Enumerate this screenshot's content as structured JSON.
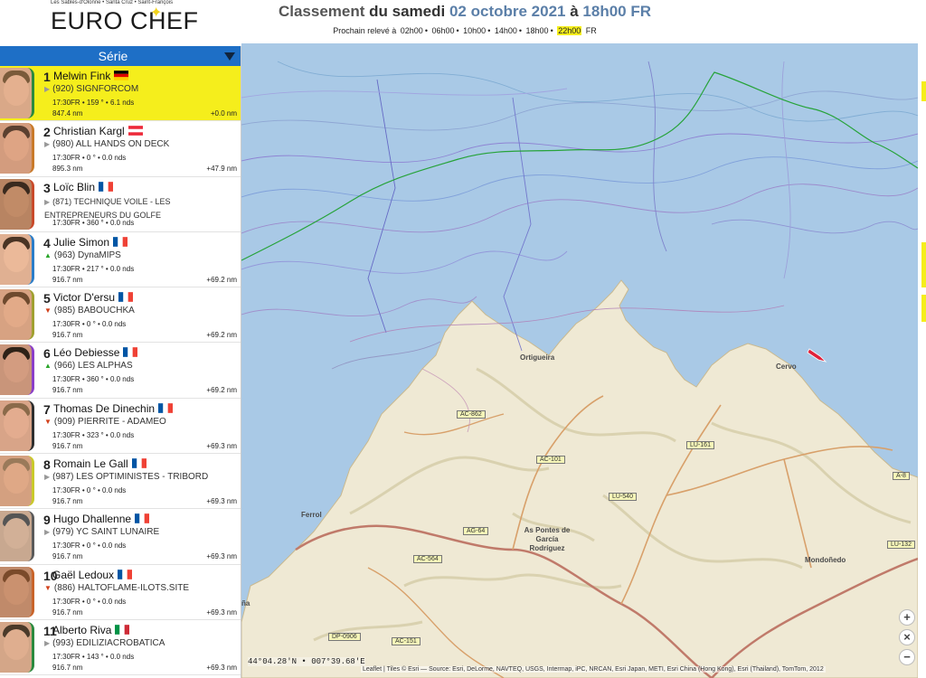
{
  "header": {
    "logo_tagline": "Les Sables-d'Olonne • Santa Cruz • Saint-François",
    "logo_brand": "EURO CHEF",
    "title_prefix": "Classement",
    "title_mid": "du samedi",
    "title_date": "02 octobre 2021",
    "title_a": "à",
    "title_time": "18h00 FR",
    "next_label": "Prochain relevé à",
    "next_slots": [
      "02h00",
      "06h00",
      "10h00",
      "14h00",
      "18h00",
      "22h00"
    ],
    "next_current": "22h00",
    "next_suffix": "FR"
  },
  "sidebar": {
    "serie_label": "Série",
    "rows": [
      {
        "rank": "1",
        "name": "Melwin Fink",
        "flag": "de",
        "trend": "none",
        "boat": "(920) SIGNFORCOM",
        "stats": "17:30FR • 159 ° • 6.1 nds",
        "dist": "847.4 nm",
        "gap": "+0.0 nm",
        "skin": "#d9a888",
        "hair": "#7a5a3a",
        "border": "#2b8a3e"
      },
      {
        "rank": "2",
        "name": "Christian Kargl",
        "flag": "at",
        "trend": "none",
        "boat": "(980) ALL HANDS ON DECK",
        "stats": "17:30FR • 0 ° • 0.0 nds",
        "dist": "895.3 nm",
        "gap": "+47.9 nm",
        "skin": "#d39c7e",
        "hair": "#5b4030",
        "border": "#c97a2a"
      },
      {
        "rank": "3",
        "name": "Loïc Blin",
        "flag": "fr",
        "trend": "none",
        "boat": "(871) TECHNIQUE VOILE - LES ENTREPRENEURS DU GOLFE",
        "stats": "17:30FR • 360 ° • 0.0 nds",
        "dist": "",
        "gap": "",
        "skin": "#b88462",
        "hair": "#3a2a1e",
        "border": "#c94a2a"
      },
      {
        "rank": "4",
        "name": "Julie Simon",
        "flag": "fr",
        "trend": "up",
        "boat": "(963) DynaMIPS",
        "stats": "17:30FR • 217 ° • 0.0 nds",
        "dist": "916.7 nm",
        "gap": "+69.2 nm",
        "skin": "#e0b092",
        "hair": "#4a3424",
        "border": "#2a7dc9"
      },
      {
        "rank": "5",
        "name": "Victor D'ersu",
        "flag": "fr",
        "trend": "down",
        "boat": "(985) BABOUCHKA",
        "stats": "17:30FR • 0 ° • 0.0 nds",
        "dist": "916.7 nm",
        "gap": "+69.2 nm",
        "skin": "#d7a282",
        "hair": "#6e4a2e",
        "border": "#a0a030"
      },
      {
        "rank": "6",
        "name": "Léo Debiesse",
        "flag": "fr",
        "trend": "up",
        "boat": "(966) LES ALPHAS",
        "stats": "17:30FR • 360 ° • 0.0 nds",
        "dist": "916.7 nm",
        "gap": "+69.2 nm",
        "skin": "#c9957a",
        "hair": "#2e2218",
        "border": "#8a3ec9"
      },
      {
        "rank": "7",
        "name": "Thomas De Dinechin",
        "flag": "fr",
        "trend": "down",
        "boat": "(909) PIERRITE - ADAMEO",
        "stats": "17:30FR • 323 ° • 0.0 nds",
        "dist": "916.7 nm",
        "gap": "+69.3 nm",
        "skin": "#d8a488",
        "hair": "#8a6a4a",
        "border": "#2e2e2e"
      },
      {
        "rank": "8",
        "name": "Romain Le Gall",
        "flag": "fr",
        "trend": "none",
        "boat": "(987) LES OPTIMINISTES - TRIBORD",
        "stats": "17:30FR • 0 ° • 0.0 nds",
        "dist": "916.7 nm",
        "gap": "+69.3 nm",
        "skin": "#d4a080",
        "hair": "#9a7a5a",
        "border": "#c9c92a"
      },
      {
        "rank": "9",
        "name": "Hugo Dhallenne",
        "flag": "fr",
        "trend": "none",
        "boat": "(979) YC SAINT LUNAIRE",
        "stats": "17:30FR • 0 ° • 0.0 nds",
        "dist": "916.7 nm",
        "gap": "+69.3 nm",
        "skin": "#c8a890",
        "hair": "#555555",
        "border": "#5a5a5a"
      },
      {
        "rank": "10",
        "name": "Gaël Ledoux",
        "flag": "fr",
        "trend": "down",
        "boat": "(886) HALTOFLAME-ILOTS.SITE",
        "stats": "17:30FR • 0 ° • 0.0 nds",
        "dist": "916.7 nm",
        "gap": "+69.3 nm",
        "skin": "#c08a6a",
        "hair": "#7a4a2a",
        "border": "#c9642a"
      },
      {
        "rank": "11",
        "name": "Alberto Riva",
        "flag": "it",
        "trend": "none",
        "boat": "(993) EDILIZIACROBATICA",
        "stats": "17:30FR • 143 ° • 0.0 nds",
        "dist": "916.7 nm",
        "gap": "+69.3 nm",
        "skin": "#d4a688",
        "hair": "#4a3a2a",
        "border": "#2a8a3e"
      }
    ]
  },
  "map": {
    "places": [
      "Ortigueira",
      "Cervo",
      "As Pontes de García Rodríguez",
      "Ferrol",
      "Mondoñedo",
      "ña"
    ],
    "roads": [
      "AC-862",
      "AC-101",
      "LU-161",
      "LU-540",
      "AG-64",
      "AC-564",
      "DP-0906",
      "AC-151",
      "LU-132",
      "A-8"
    ],
    "coords": "44°04.28'N • 007°39.68'E",
    "attribution": "Leaflet | Tiles © Esri — Source: Esri, DeLorme, NAVTEQ, USGS, Intermap, iPC, NRCAN, Esri Japan, METI, Esri China (Hong Kong), Esri (Thailand), TomTom, 2012",
    "zoom_in": "+",
    "reset": "×",
    "zoom_out": "−",
    "colors": {
      "sea": "#a9c9e6",
      "land": "#efe9d4",
      "relief": "#d7cfac",
      "leader_track": "#27a33a",
      "boat_marker": "#e0213a"
    }
  }
}
